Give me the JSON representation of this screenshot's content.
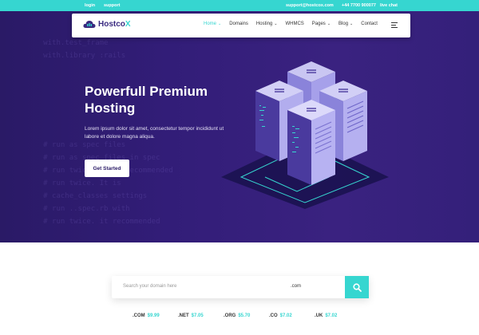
{
  "topbar": {
    "login": "login",
    "support": "support",
    "email": "support@hostcox.com",
    "phone": "+44 7700 900077",
    "live_chat": "live chat"
  },
  "nav": {
    "logo_main": "Hostco",
    "logo_accent": "X",
    "items": [
      {
        "label": "Home",
        "dropdown": true,
        "active": true
      },
      {
        "label": "Domains",
        "dropdown": false
      },
      {
        "label": "Hosting",
        "dropdown": true
      },
      {
        "label": "WHMCS",
        "dropdown": false
      },
      {
        "label": "Pages",
        "dropdown": true
      },
      {
        "label": "Blog",
        "dropdown": true
      },
      {
        "label": "Contact",
        "dropdown": false
      }
    ]
  },
  "hero": {
    "title": "Powerfull Premium Hosting",
    "text": "Lorem ipsum dolor sit amet, consectetur tempor incididunt ut labore et dolore magna aliqua.",
    "button": "Get Started"
  },
  "domain_search": {
    "placeholder": "Search your domain here",
    "tld": ".com"
  },
  "prices": [
    {
      "ext": ".COM",
      "price": "$9.99"
    },
    {
      "ext": ".NET",
      "price": "$7.05"
    },
    {
      "ext": ".ORG",
      "price": "$5.70"
    },
    {
      "ext": ".CO",
      "price": "$7.02"
    },
    {
      "ext": ".UK",
      "price": "$7.02"
    }
  ],
  "colors": {
    "accent": "#36d6d0",
    "hero_bg": "#2a1a66",
    "brand_dark": "#3a2a80"
  },
  "icons": [
    "cloud-logo-icon",
    "chevron-down-icon",
    "menu-icon",
    "search-icon",
    "server-illustration"
  ]
}
